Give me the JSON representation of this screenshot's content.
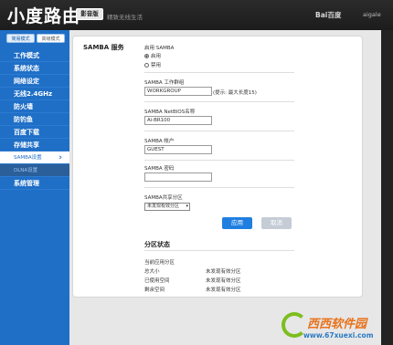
{
  "header": {
    "brand": "小度路由",
    "badge": "影音版",
    "slogan": "精致无线生活",
    "partner_logo": "Bai百度",
    "partner_logo2": "aigale"
  },
  "sidebar": {
    "mode_tabs": [
      {
        "label": "简易模式",
        "active": true
      },
      {
        "label": "高级模式",
        "active": false
      }
    ],
    "items": [
      {
        "label": "工作模式"
      },
      {
        "label": "系统状态"
      },
      {
        "label": "网络设定"
      },
      {
        "label": "无线2.4GHz"
      },
      {
        "label": "防火墙"
      },
      {
        "label": "防钓鱼"
      },
      {
        "label": "百度下载"
      },
      {
        "label": "存储共享"
      },
      {
        "label": "SAMBA设置",
        "active": true
      },
      {
        "label": "DLNA设置",
        "sub": true
      },
      {
        "label": "系统管理"
      }
    ]
  },
  "samba": {
    "section_title": "SAMBA 服务",
    "enable_label": "启用 SAMBA",
    "options": [
      {
        "label": "启用",
        "selected": true
      },
      {
        "label": "禁用",
        "selected": false
      }
    ],
    "workgroup_label": "SAMBA 工作群组",
    "workgroup_value": "WORKGROUP",
    "workgroup_hint": "(提示: 最大长度15)",
    "netbios_label": "SAMBA NetBIOS名称",
    "netbios_value": "Ai-BR100",
    "account_label": "SAMBA 帐户",
    "account_value": "GUEST",
    "password_label": "SAMBA 密码",
    "password_value": "",
    "share_label": "SAMBA共享分区",
    "share_selected": "未发现有效分区",
    "apply_label": "应用",
    "cancel_label": "取消"
  },
  "partition": {
    "section_title": "分区状态",
    "rows": [
      {
        "label": "当前应用分区",
        "value": ""
      },
      {
        "label": "总大小",
        "value": "未发现有效分区"
      },
      {
        "label": "已使用空间",
        "value": "未发现有效分区"
      },
      {
        "label": "剩余空间",
        "value": "未发现有效分区"
      }
    ]
  },
  "watermark": {
    "text": "西西软件园",
    "url": "www.67xuexi.com"
  },
  "colors": {
    "sidebar": "#1f6fc7",
    "header": "#232323",
    "apply": "#1f7fe0",
    "cancel": "#c5ccd6"
  }
}
